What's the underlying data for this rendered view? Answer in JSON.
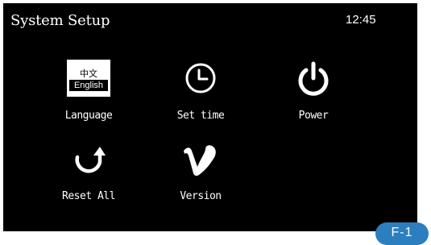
{
  "header": {
    "title": "System Setup",
    "time": "12:45"
  },
  "menu": {
    "language": {
      "label": "Language",
      "icon_top": "中文",
      "icon_bottom": "English",
      "icon": "language-icon"
    },
    "set_time": {
      "label": "Set time",
      "icon": "clock-icon"
    },
    "power": {
      "label": "Power",
      "icon": "power-icon"
    },
    "reset_all": {
      "label": "Reset All",
      "icon": "reset-arrow-icon"
    },
    "version": {
      "label": "Version",
      "icon": "version-v-icon"
    }
  },
  "figure_badge": {
    "text": "F-1",
    "color": "#2b7fbf"
  },
  "colors": {
    "screen_background": "#000000",
    "text": "#ffffff"
  }
}
